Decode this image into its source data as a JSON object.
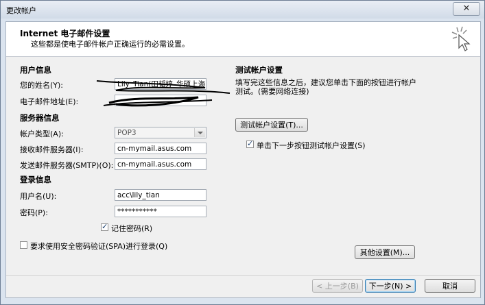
{
  "window": {
    "title": "更改帐户",
    "close_glyph": "✕"
  },
  "header": {
    "title": "Internet 电子邮件设置",
    "subtitle": "这些都是使电子邮件帐户正确运行的必需设置。"
  },
  "user_info": {
    "heading": "用户信息",
    "name_label": "您的姓名(Y):",
    "name_value": "Lily_Tian(田韬婷_华硕上海)",
    "email_label": "电子邮件地址(E):",
    "email_value": ""
  },
  "server_info": {
    "heading": "服务器信息",
    "account_type_label": "帐户类型(A):",
    "account_type_value": "POP3",
    "incoming_label": "接收邮件服务器(I):",
    "incoming_value": "cn-mymail.asus.com",
    "outgoing_label": "发送邮件服务器(SMTP)(O):",
    "outgoing_value": "cn-mymail.asus.com"
  },
  "login_info": {
    "heading": "登录信息",
    "username_label": "用户名(U):",
    "username_value": "acc\\lily_tian",
    "password_label": "密码(P):",
    "password_value": "***********",
    "remember_label": "记住密码(R)",
    "remember_checked": true,
    "spa_label": "要求使用安全密码验证(SPA)进行登录(Q)",
    "spa_checked": false
  },
  "test": {
    "heading": "测试帐户设置",
    "desc": "填写完这些信息之后，建议您单击下面的按钮进行帐户测试。(需要网络连接)",
    "button": "测试帐户设置(T)...",
    "auto_label": "单击下一步按钮测试帐户设置(S)",
    "auto_checked": true
  },
  "buttons": {
    "more": "其他设置(M)...",
    "back": "< 上一步(B)",
    "next": "下一步(N) >",
    "cancel": "取消"
  }
}
